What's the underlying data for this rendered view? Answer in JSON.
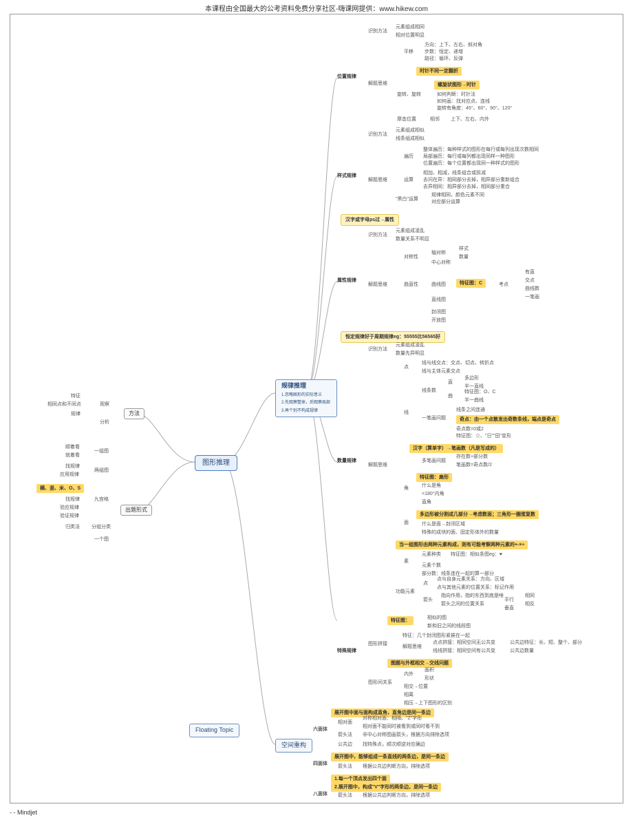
{
  "header": "本课程由全国最大的公考资料免费分享社区-嗨课网提供：www.hikew.com",
  "footer": "-  - Mindjet",
  "root": "图形推理",
  "floating": "Floating Topic",
  "method": {
    "label": "方法",
    "observe": "观察",
    "analyze": "分析",
    "items": [
      "特征",
      "相同点和不同点",
      "规律"
    ]
  },
  "form": {
    "label": "出题形式",
    "rows": [
      {
        "l": "顺着看",
        "r": "一组图"
      },
      {
        "l": "就着看",
        "r": ""
      },
      {
        "l": "找规律",
        "r": "两组图"
      },
      {
        "l": "应用规律",
        "r": ""
      },
      {
        "l": "找规律",
        "r": "九宫格"
      },
      {
        "l": "验应规律",
        "r": ""
      },
      {
        "l": "验证规律",
        "r": ""
      },
      {
        "l": "归类法",
        "r": "分组分类"
      },
      {
        "l": "",
        "r": "一个图"
      }
    ],
    "highlight": "横、竖、米、O、S"
  },
  "reason": {
    "title": "规律推理",
    "desc": [
      "1.忽略图形的实际意义",
      "2.先观察整体，后观察局部",
      "3.再个别不构成规律"
    ]
  },
  "pos": {
    "title": "位置规律",
    "m1": "识别方法",
    "m1a": "元素组成相同",
    "m1b": "相对位置明显",
    "m2": "解题思维",
    "pingyi": "平移",
    "pingyi_a": "方向：上下、左右、斜对角",
    "pingyi_b": "步数：恒定、递增",
    "pingyi_c": "路径：循环、反弹",
    "xuanzhuan": "旋转、旋转",
    "xz_hl1": "时针不同一定翻折",
    "xz_hl2": "螺旋状图形→时针",
    "xz_a": "如何判断：时针法",
    "xz_b": "如何画：找对应点、连线",
    "xz_c": "旋转有角度：45°、60°、90°、120°",
    "mohu": "摩态位置",
    "mohu_a": "相邻",
    "mohu_b": "上下、左右、内外"
  },
  "style": {
    "title": "样式规律",
    "m1": "识别方法",
    "m1a": "元素组成相似",
    "m1b": "线条组成相似",
    "m2": "解题思维",
    "bianli": "遍历",
    "bl_a": "整体遍历：每种样式的图形在每行或每列出现次数相同",
    "bl_b": "局部遍历：每行或每列都出现同样一种图形",
    "bl_c": "位置遍历：每个位置都出现同一种样式的图形",
    "yunsuan": "运算",
    "ys_a": "相加、相减，线条组合或拆减",
    "ys_b": "去问在异：相同部分去掉，相异部分重新组合",
    "ys_c": "去异相同：相异部分去掉，相同部分重合",
    "heibai": "\"黑白\"运算",
    "hb_a": "规律相同，颜色元素不同",
    "hb_b": "对应部分运算"
  },
  "attr": {
    "title": "属性规律",
    "tip": "汉字或字母ps过→属性",
    "m1": "识别方法",
    "m1a": "元素组成凌乱",
    "m1b": "数量关系不明显",
    "m2": "解题思维",
    "duichen": "对称性",
    "dc_a": "轴对称",
    "dc_b": "中心对称",
    "dc_c": "样式",
    "dc_d": "数量",
    "quzhi": "曲直性",
    "qz_a": "曲线图",
    "qz_hl": "特征图：C",
    "qz_b": "考点",
    "qz_c": "有直",
    "qz_d": "交点",
    "qz_e": "曲线数",
    "qz_f": "一笔画",
    "qz_g": "直线图",
    "kaifeng": "封闭图",
    "kf_a": "开放图"
  },
  "qty": {
    "title": "数量规律",
    "tip": "恒定规律好于周期规律eg：55555比56565好",
    "m1": "识别方法",
    "m1a": "元素组成凌乱",
    "m1b": "数量先异明显",
    "m2": "解题思维",
    "dian": "点",
    "d_a": "线与线交点：交点、切点、转折点",
    "d_b": "线与主体元素交点",
    "xian": "线",
    "xt": "线条数",
    "xt_a": "直",
    "xt_b": "曲",
    "xt_c": "多边形",
    "xt_d": "半一直线",
    "xt_e": "特征图：O、C",
    "xt_f": "半一曲线",
    "yibi": "一笔画问题",
    "yb_a": "线条之间连通",
    "yb_hl": "奇点：由一个点散发出奇数条线，端点是奇点",
    "yb_b": "奇点数=0或2",
    "yb_c": "特征图：☆、\"日\"\"田\"变形",
    "hanzi_hl": "汉字（算单字）→笔画数（凡是写成的）",
    "hz_a": "存在数+部分数",
    "hz_b": "多笔画问题",
    "hz_c": "笔画数=奇点数/2",
    "jiao": "角",
    "j_hl": "特征图：扇形",
    "j_a": "什么是角",
    "j_b": "<180°内角",
    "j_c": "直角",
    "mian": "面",
    "m_hl": "多边形被分割成几部分→考虑数面；三角形一圈蛋复数",
    "m_a": "什么是面→封闭区域",
    "m_b": "特殊的成块的面、固定形体外的数量",
    "su": "素",
    "s_hl": "当一组图形由两种元素构成，则有可能考察两种元素的+-×÷",
    "s_a": "元素种类",
    "s_b": "特征图：相似条图eg：♥",
    "s_c": "元素个数",
    "s_d": "部分数：线条连在一起的算一部分",
    "gn": "功能元素",
    "gn_a": "点",
    "gn_b": "点与自身元素关系：方向、区域",
    "gn_c": "点与其他元素的位置关系：标记作用",
    "gn_d": "箭头",
    "gn_e": "指向作用，指的东西到底是啥",
    "gn_f": "箭头之间的位置关系",
    "gn_g": "平行",
    "gn_h": "相同",
    "gn_i": "垂直",
    "gn_j": "相反"
  },
  "spec": {
    "title": "特殊规律",
    "hl": "特征图：",
    "a": "相似的图",
    "b": "新和旧之间的线段图",
    "c": "图形拼接",
    "d": "特征：几个封闭图形紧挨在一起",
    "e": "解题思维",
    "f": "点点拼接：相同空间无公共变",
    "g": "线线拼接：相同空间有公共变",
    "h": "公共边特征：长、短、整个、部分",
    "i": "公共边数量",
    "gx_hl": "图题与外框相交→交线问题",
    "gx": "图形间关系",
    "gx_a": "内外",
    "gx_b": "面积",
    "gx_c": "形状",
    "gx_d": "相交→位置",
    "gx_e": "相离",
    "gx_f": "相压→上下图形的区别"
  },
  "space": {
    "title": "空间重构",
    "liu": "六面体",
    "liu_hl": "展开图中面与面构成直角，直角边是同一条边",
    "liu_a": "相对面",
    "liu_b": "对称相对面：相隔、\"Z\"字形",
    "liu_c": "相对面不能同时被看到或同时看不到",
    "liu_d": "箭头法",
    "liu_e": "非中心对称图画箭头，根据方向排除选项",
    "liu_f": "公共边",
    "liu_g": "找特殊点，顺次顺逆对应确边",
    "si": "四面体",
    "si_hl": "展开图中，能够组成一条直线的两条边，是同一条边",
    "si_a": "箭头法",
    "si_b": "根据公共边判断方向，排除选项",
    "ba": "八面体",
    "ba_hl1": "1.每一个顶点发出四个面",
    "ba_hl2": "2.展开图中，构成\"V\"字形的两条边，是同一条边",
    "ba_a": "箭头法",
    "ba_b": "根据公共边判断方向，排除选项"
  }
}
